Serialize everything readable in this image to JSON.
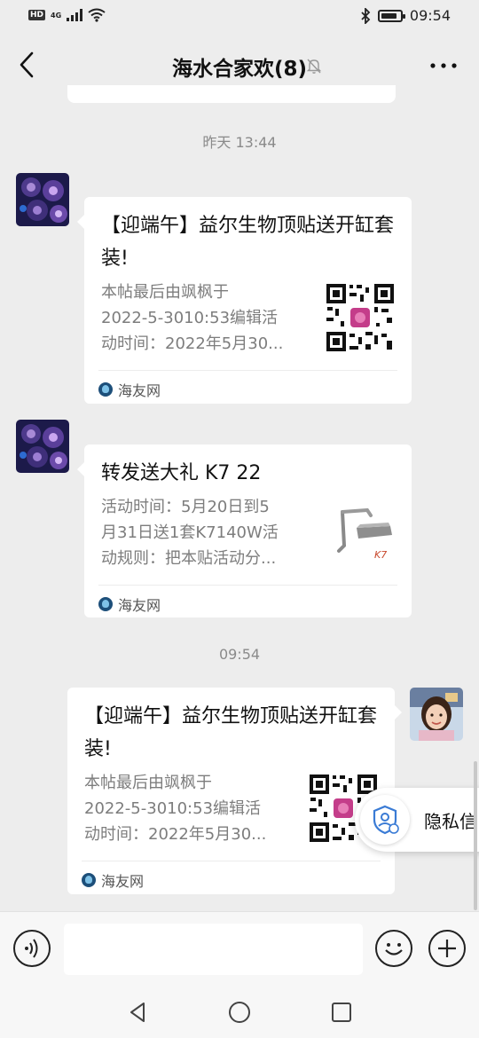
{
  "status_bar": {
    "network_badge": "HD",
    "network_type": "4G",
    "time": "09:54",
    "battery_level": 0.85
  },
  "nav": {
    "title": "海水合家欢(8)",
    "icons": {
      "back": "chevron-left-icon",
      "mute": "bell-off-icon",
      "more": "more-dots-icon"
    }
  },
  "messages": [
    {
      "type": "time",
      "text": "昨天 13:44"
    },
    {
      "type": "link_card",
      "side": "left",
      "avatar": "coral-avatar",
      "title": "【迎端午】益尔生物顶贴送开缸套装!",
      "description": "本帖最后由飒枫于\n2022-5-3010:53编辑活\n动时间：2022年5月30...",
      "thumbnail": "qr-code-thumb",
      "source": "海友网"
    },
    {
      "type": "link_card",
      "side": "left",
      "avatar": "coral-avatar",
      "title": "转发送大礼 K7 22",
      "description": "活动时间：5月20日到5\n月31日送1套K7140W活\n动规则：把本贴活动分...",
      "thumbnail": "aquarium-light-thumb",
      "source": "海友网"
    },
    {
      "type": "time",
      "text": "09:54"
    },
    {
      "type": "link_card",
      "side": "right",
      "avatar": "child-photo-avatar",
      "title": "【迎端午】益尔生物顶贴送开缸套装!",
      "description": "本帖最后由飒枫于\n2022-5-3010:53编辑活\n动时间：2022年5月30...",
      "thumbnail": "qr-code-thumb",
      "source": "海友网"
    }
  ],
  "privacy_popup": {
    "label": "隐私信",
    "icon": "shield-user-icon"
  },
  "input_bar": {
    "placeholder": "",
    "value": "",
    "icons": {
      "voice": "voice-icon",
      "emoji": "emoji-icon",
      "more": "plus-icon"
    }
  },
  "system_nav": {
    "icons": [
      "back-triangle-icon",
      "home-circle-icon",
      "recent-square-icon"
    ]
  }
}
